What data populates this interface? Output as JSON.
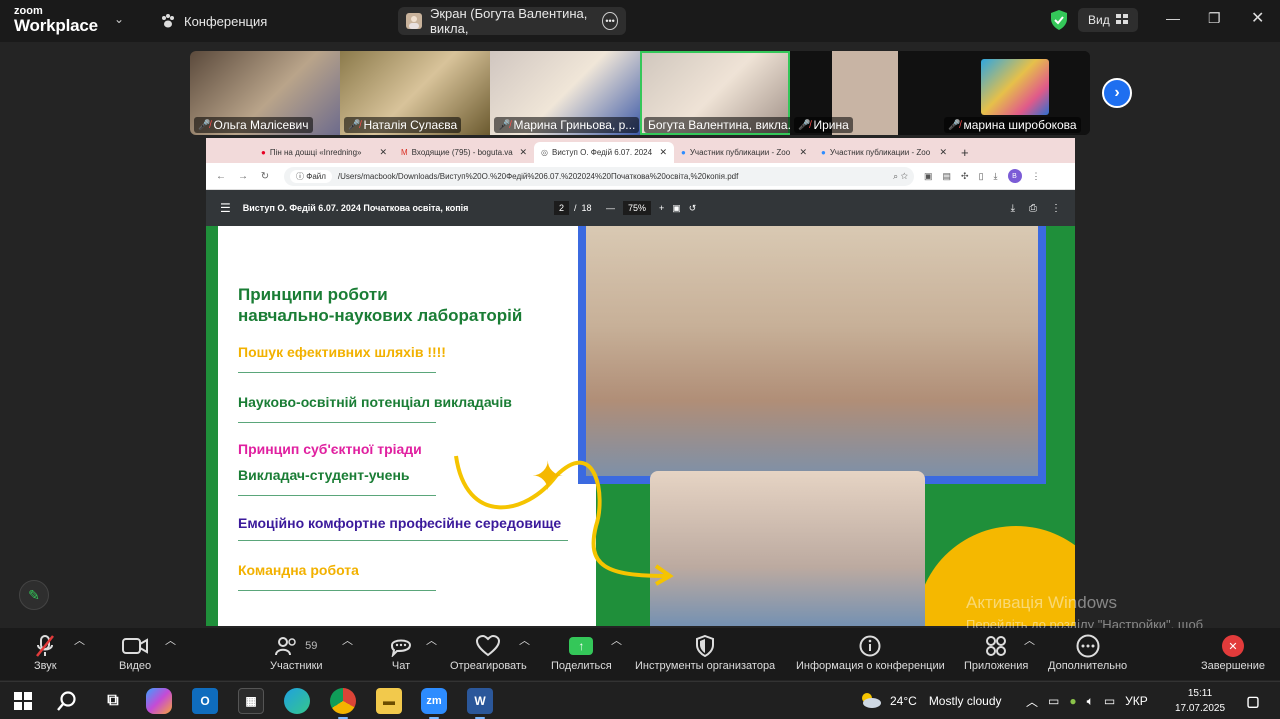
{
  "app": {
    "logo_line1": "zoom",
    "logo_line2": "Workplace",
    "tab_conference": "Конференция",
    "tab_screen": "Экран (Богута Валентина, викла,",
    "view_label": "Вид"
  },
  "participants": [
    {
      "name": "Ольга Малісевич"
    },
    {
      "name": "Наталія Сулаєва"
    },
    {
      "name": "Марина Гриньова, р..."
    },
    {
      "name": "Богута Валентина, викла..."
    },
    {
      "name": "Ирина"
    },
    {
      "name": "марина широбокова"
    }
  ],
  "browser": {
    "tabs": [
      {
        "label": "Пін на дошці «Inredning»"
      },
      {
        "label": "Входящие (795) - boguta.va"
      },
      {
        "label": "Виступ О. Федій 6.07. 2024"
      },
      {
        "label": "Участник публикации - Zoo"
      },
      {
        "label": "Участник публикации - Zoo"
      }
    ],
    "file_chip": "Файл",
    "url": "/Users/macbook/Downloads/Виступ%20О.%20Федій%206.07.%202024%20Початкова%20освіта,%20копія.pdf",
    "profile": "B"
  },
  "pdf": {
    "title": "Виступ О. Федій 6.07. 2024 Початкова освіта, копія",
    "page_current": "2",
    "page_sep": "/",
    "page_total": "18",
    "zoom": "75%"
  },
  "slide": {
    "title_line1": "Принципи роботи",
    "title_line2": "навчально-наукових лабораторій",
    "item1": "Пошук ефективних шляхів !!!!",
    "item2": "Науково-освітній потенціал викладачів",
    "item3a": "Принцип суб'єктної тріади",
    "item3b": "Викладач-студент-учень",
    "item4": "Емоційно комфортне професійне середовище",
    "item5": "Командна робота",
    "colors": {
      "title": "#1a7d35",
      "yellow": "#f2b100",
      "pink": "#e020a0",
      "purple": "#3b1a9b"
    }
  },
  "watermark": {
    "line1": "Активація Windows",
    "line2": "Перейдіть до розділу \"Настройки\", щоб активувати Windows."
  },
  "controls": {
    "audio": "Звук",
    "video": "Видео",
    "participants": "Участники",
    "participants_count": "59",
    "chat": "Чат",
    "react": "Отреагировать",
    "share": "Поделиться",
    "host_tools": "Инструменты организатора",
    "meeting_info": "Информация о конференции",
    "apps": "Приложения",
    "more": "Дополнительно",
    "end": "Завершение"
  },
  "taskbar": {
    "weather_temp": "24°C",
    "weather_text": "Mostly cloudy",
    "lang": "УКР",
    "time": "15:11",
    "date": "17.07.2025"
  }
}
